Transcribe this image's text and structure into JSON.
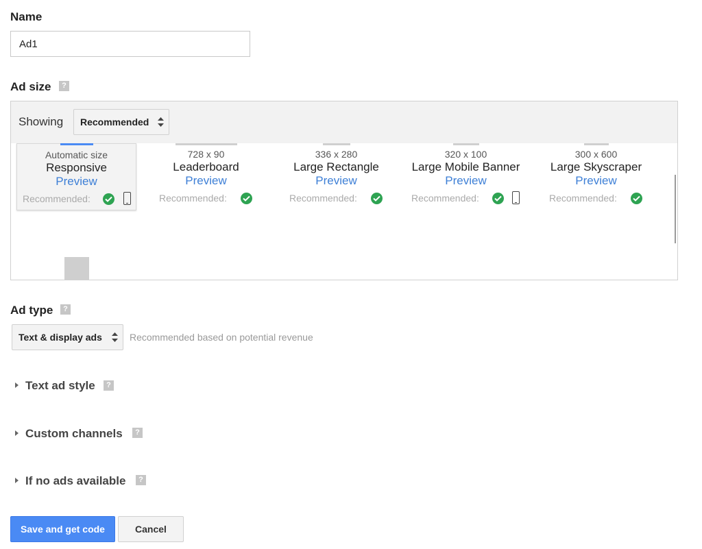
{
  "name_section": {
    "label": "Name",
    "value": "Ad1"
  },
  "ad_size": {
    "label": "Ad size",
    "help_glyph": "?",
    "showing_label": "Showing",
    "showing_value": "Recommended",
    "recommended_label": "Recommended:",
    "preview_label": "Preview",
    "sizes": [
      {
        "dims": "Automatic size",
        "name": "Responsive",
        "selected": true,
        "mobile": true
      },
      {
        "dims": "728 x 90",
        "name": "Leaderboard",
        "selected": false,
        "mobile": false
      },
      {
        "dims": "336 x 280",
        "name": "Large Rectangle",
        "selected": false,
        "mobile": false
      },
      {
        "dims": "320 x 100",
        "name": "Large Mobile Banner",
        "selected": false,
        "mobile": true
      },
      {
        "dims": "300 x 600",
        "name": "Large Skyscraper",
        "selected": false,
        "mobile": false
      }
    ]
  },
  "ad_type": {
    "label": "Ad type",
    "value": "Text & display ads",
    "hint": "Recommended based on potential revenue"
  },
  "collapsibles": [
    {
      "label": "Text ad style"
    },
    {
      "label": "Custom channels"
    },
    {
      "label": "If no ads available"
    }
  ],
  "buttons": {
    "save": "Save and get code",
    "cancel": "Cancel"
  },
  "colors": {
    "primary_button": "#4a8af4",
    "link": "#3d7fd6",
    "check": "#2ea352"
  }
}
